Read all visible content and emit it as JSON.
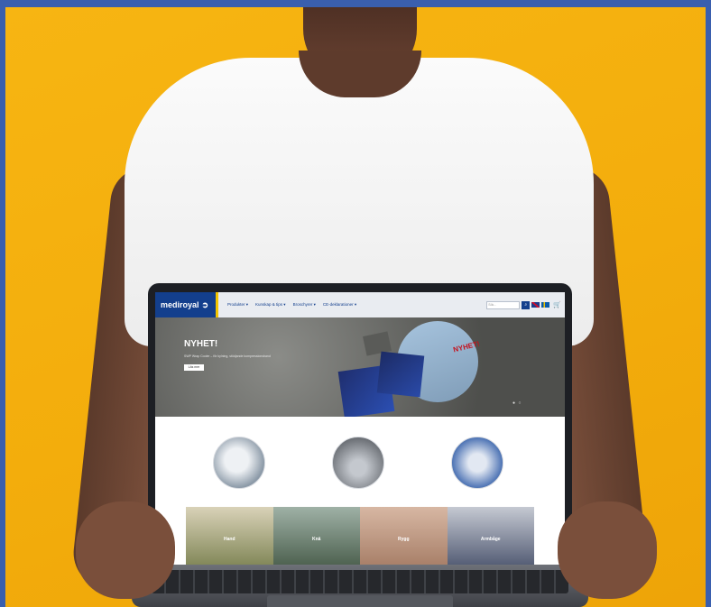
{
  "site": {
    "logo_text": "mediroyal",
    "nav": [
      "Produkter ▾",
      "Kunskap & tips ▾",
      "Broschyrer ▾",
      "CE-deklarationer ▾"
    ],
    "search_placeholder": "Sök...",
    "search_icon": "search-icon"
  },
  "hero": {
    "title": "NYHET!",
    "subtitle": "SWP Wrap Cooler – för kylning, stödjande kompressionsband",
    "button_label": "Läs mer",
    "badge": "NYHET!"
  },
  "categories": [
    "Hand",
    "Knä",
    "Rygg",
    "Armbåge"
  ],
  "colors": {
    "background": "#f3ad0c",
    "frame": "#3a5fae",
    "brand": "#133f8d"
  }
}
